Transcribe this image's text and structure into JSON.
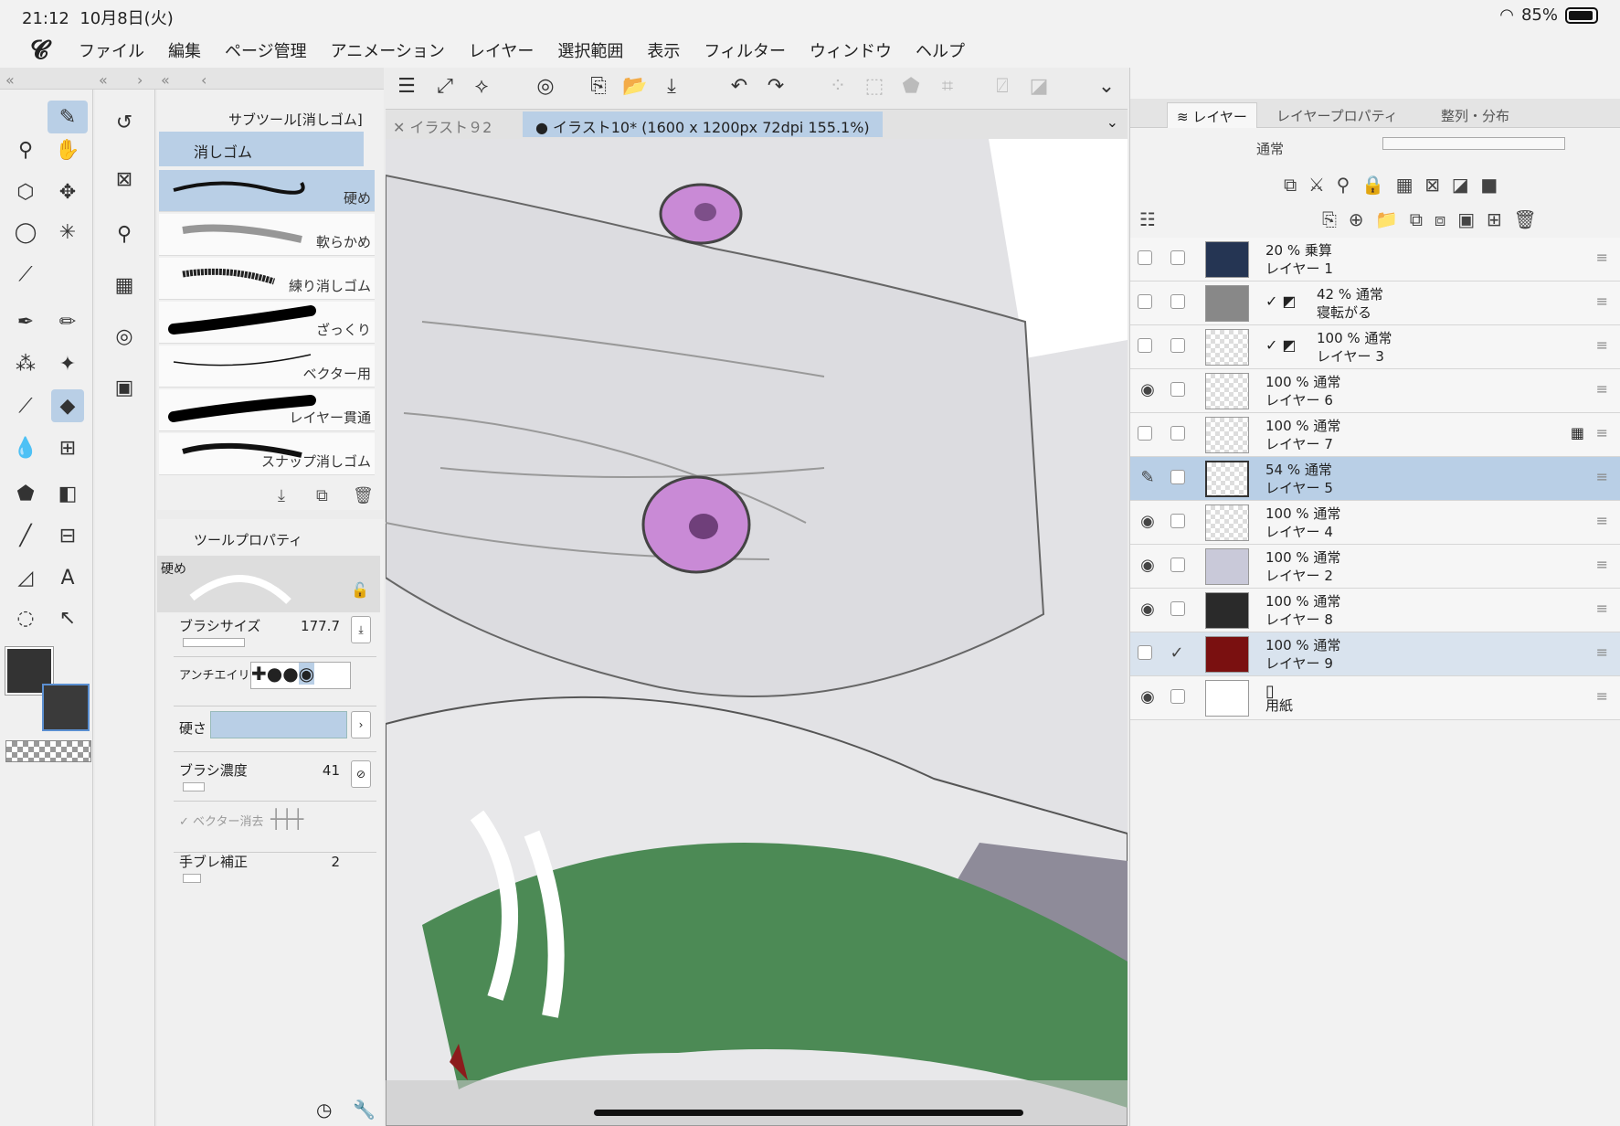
{
  "status": {
    "time": "21:12",
    "date": "10月8日(火)",
    "battery": "85%"
  },
  "menu": [
    "ファイル",
    "編集",
    "ページ管理",
    "アニメーション",
    "レイヤー",
    "選択範囲",
    "表示",
    "フィルター",
    "ウィンドウ",
    "ヘルプ"
  ],
  "subtool": {
    "title": "サブツール[消しゴム]",
    "group": "消しゴム",
    "brushes": [
      "硬め",
      "軟らかめ",
      "練り消しゴム",
      "ざっくり",
      "ベクター用",
      "レイヤー貫通",
      "スナップ消しゴム"
    ]
  },
  "toolprop": {
    "title": "ツールプロパティ",
    "preset": "硬め",
    "brush_size_label": "ブラシサイズ",
    "brush_size": "177.7",
    "antialias_label": "アンチエイリ",
    "hardness_label": "硬さ",
    "density_label": "ブラシ濃度",
    "density": "41",
    "vector_label": "ベクター消去",
    "stabilize_label": "手ブレ補正",
    "stabilize": "2"
  },
  "tabs": {
    "inactive": "イラスト９2",
    "active": "イラスト10* (1600 x 1200px 72dpi 155.1%)"
  },
  "layerpanel": {
    "tabs": [
      "レイヤー",
      "レイヤープロパティ",
      "整列・分布"
    ],
    "blend": "通常",
    "layers": [
      {
        "opacity": "20 % 乗算",
        "name": "レイヤー 1"
      },
      {
        "opacity": "42 % 通常",
        "name": "寝転がる"
      },
      {
        "opacity": "100 % 通常",
        "name": "レイヤー 3"
      },
      {
        "opacity": "100 % 通常",
        "name": "レイヤー 6"
      },
      {
        "opacity": "100 % 通常",
        "name": "レイヤー 7"
      },
      {
        "opacity": "54 % 通常",
        "name": "レイヤー 5"
      },
      {
        "opacity": "100 % 通常",
        "name": "レイヤー 4"
      },
      {
        "opacity": "100 % 通常",
        "name": "レイヤー 2"
      },
      {
        "opacity": "100 % 通常",
        "name": "レイヤー 8"
      },
      {
        "opacity": "100 % 通常",
        "name": "レイヤー 9"
      },
      {
        "opacity": "",
        "name": "用紙"
      }
    ]
  },
  "colors": {
    "accent": "#b9cfe6",
    "main_color": "#333333"
  }
}
